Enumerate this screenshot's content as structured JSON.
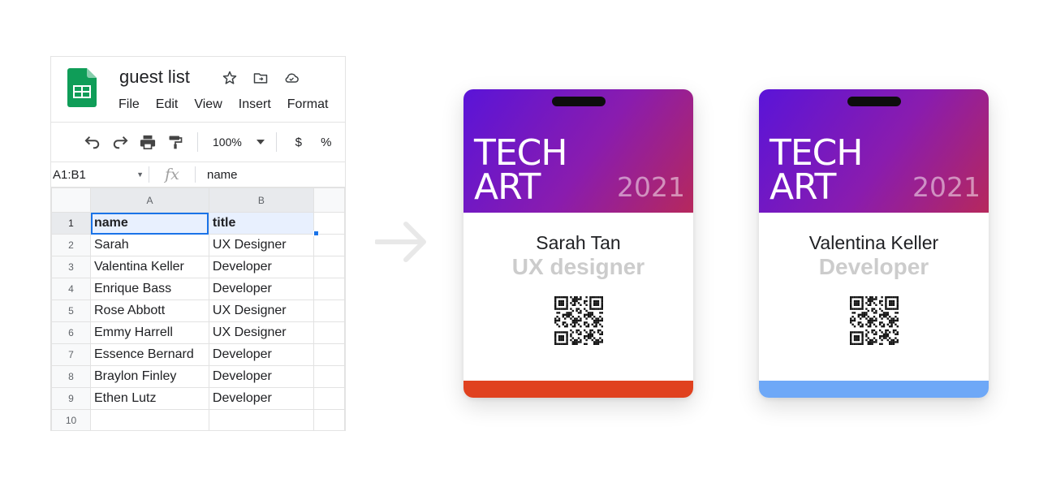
{
  "sheet": {
    "title": "guest list",
    "menu": [
      "File",
      "Edit",
      "View",
      "Insert",
      "Format"
    ],
    "toolbar": {
      "zoom": "100%",
      "currency": "$",
      "percent": "%"
    },
    "formula": {
      "cell_ref": "A1:B1",
      "fx": "fx",
      "value": "name"
    },
    "columns": [
      "A",
      "B"
    ],
    "row_numbers": [
      "1",
      "2",
      "3",
      "4",
      "5",
      "6",
      "7",
      "8",
      "9",
      "10"
    ],
    "rows": [
      [
        "name",
        "title"
      ],
      [
        "Sarah",
        "UX Designer"
      ],
      [
        "Valentina Keller",
        "Developer"
      ],
      [
        "Enrique Bass",
        "Developer"
      ],
      [
        "Rose Abbott",
        "UX Designer"
      ],
      [
        "Emmy Harrell",
        "UX Designer"
      ],
      [
        "Essence Bernard",
        "Developer"
      ],
      [
        "Braylon Finley",
        "Developer"
      ],
      [
        "Ethen Lutz",
        "Developer"
      ],
      [
        "",
        ""
      ]
    ],
    "colors": {
      "logo_green": "#0f9d58",
      "selection": "#1a73e8"
    }
  },
  "badges": [
    {
      "logo_line1": "TECH",
      "logo_line2": "ART",
      "year": "2021",
      "name": "Sarah Tan",
      "role": "UX designer",
      "stripe_color": "#e0411f"
    },
    {
      "logo_line1": "TECH",
      "logo_line2": "ART",
      "year": "2021",
      "name": "Valentina Keller",
      "role": "Developer",
      "stripe_color": "#6ea8f7"
    }
  ],
  "icons": {
    "title": [
      "star-icon",
      "move-to-folder-icon",
      "cloud-status-icon"
    ],
    "toolbar": [
      "undo-icon",
      "redo-icon",
      "print-icon",
      "paint-format-icon"
    ],
    "arrow": "arrow-right-icon",
    "badge": "qr-code-icon"
  }
}
